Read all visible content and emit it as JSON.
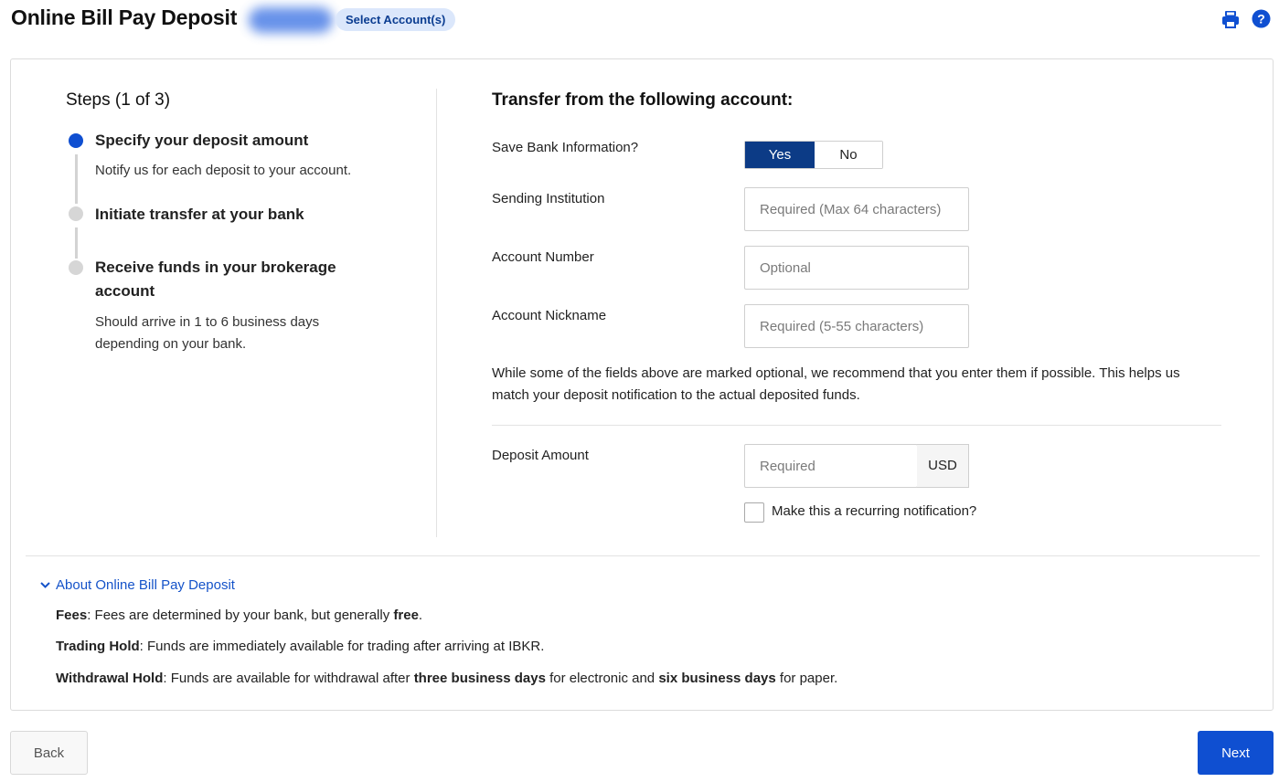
{
  "header": {
    "title": "Online Bill Pay Deposit",
    "select_accounts": "Select Account(s)",
    "accent_color": "#0f4fd1"
  },
  "steps": {
    "title": "Steps (1 of 3)",
    "items": [
      {
        "title": "Specify your deposit amount",
        "desc": "Notify us for each deposit to your account.",
        "active": true
      },
      {
        "title": "Initiate transfer at your bank",
        "desc": "",
        "active": false
      },
      {
        "title_line1": "Receive funds in your brokerage",
        "title_line2": "account",
        "desc_line1": "Should arrive in 1 to 6 business days",
        "desc_line2": "depending on your bank.",
        "active": false
      }
    ]
  },
  "form": {
    "title": "Transfer from the following account:",
    "save_bank_label": "Save Bank Information?",
    "yes_label": "Yes",
    "no_label": "No",
    "sending_institution_label": "Sending Institution",
    "sending_institution_placeholder": "Required (Max 64 characters)",
    "account_number_label": "Account Number",
    "account_number_placeholder": "Optional",
    "account_nickname_label": "Account Nickname",
    "account_nickname_placeholder": "Required (5-55 characters)",
    "note_line1": "While some of the fields above are marked optional, we recommend that you enter them if possible. This helps us",
    "note_line2": "match your deposit notification to the actual deposited funds.",
    "deposit_amount_label": "Deposit Amount",
    "deposit_amount_placeholder": "Required",
    "currency": "USD",
    "recurring_label": "Make this a recurring notification?"
  },
  "about": {
    "toggle_label": "About Online Bill Pay Deposit",
    "fees_label": "Fees",
    "fees_text": ": Fees are determined by your bank, but generally ",
    "fees_bold": "free",
    "fees_end": ".",
    "trading_hold_label": "Trading Hold",
    "trading_hold_text": ": Funds are immediately available for trading after arriving at IBKR.",
    "withdrawal_hold_label": "Withdrawal Hold",
    "withdrawal_hold_text1": ": Funds are available for withdrawal after ",
    "withdrawal_hold_bold1": "three business days",
    "withdrawal_hold_text2": " for electronic and ",
    "withdrawal_hold_bold2": "six business days",
    "withdrawal_hold_text3": " for paper."
  },
  "footer": {
    "back_label": "Back",
    "next_label": "Next"
  },
  "icons": {
    "print": "print-icon",
    "help": "help-icon",
    "chevron": "chevron-down-icon"
  }
}
